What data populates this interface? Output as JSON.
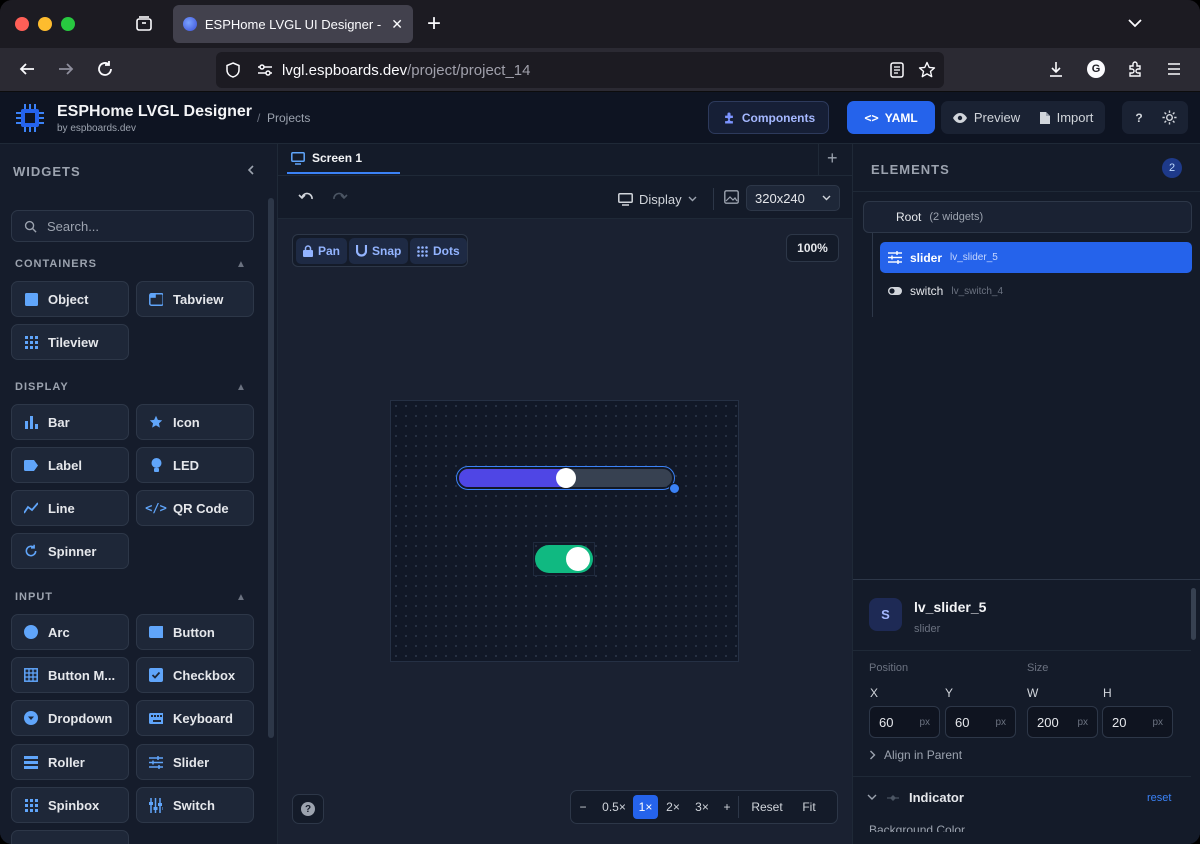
{
  "browser": {
    "tab_title": "ESPHome LVGL UI Designer - Fr",
    "url_domain": "lvgl.espboards.dev",
    "url_path": "/project/project_14",
    "avatar_letter": "G"
  },
  "header": {
    "app_title": "ESPHome LVGL Designer",
    "app_subtitle": "by espboards.dev",
    "breadcrumb_sep": "/",
    "breadcrumb": "Projects",
    "components_label": "Components",
    "yaml_label": "YAML",
    "preview_label": "Preview",
    "import_label": "Import",
    "help_label": "?"
  },
  "widgets_panel": {
    "title": "WIDGETS",
    "search_placeholder": "Search...",
    "sections": {
      "containers": "CONTAINERS",
      "display": "DISPLAY",
      "input": "INPUT"
    },
    "items": {
      "object": "Object",
      "tabview": "Tabview",
      "tileview": "Tileview",
      "bar": "Bar",
      "icon": "Icon",
      "label": "Label",
      "led": "LED",
      "line": "Line",
      "qrcode": "QR Code",
      "spinner": "Spinner",
      "arc": "Arc",
      "button": "Button",
      "buttonmatrix": "Button M...",
      "checkbox": "Checkbox",
      "dropdown": "Dropdown",
      "keyboard": "Keyboard",
      "roller": "Roller",
      "slider": "Slider",
      "spinbox": "Spinbox",
      "switch": "Switch"
    }
  },
  "canvas": {
    "screen_tab": "Screen 1",
    "add_tab": "+",
    "display_label": "Display",
    "resolution": "320x240",
    "pan_label": "Pan",
    "snap_label": "Snap",
    "dots_label": "Dots",
    "zoom_level": "100%",
    "slider_value": 0.5,
    "switch_on": true,
    "zoom_controls": {
      "minus": "−",
      "half": "0.5×",
      "one": "1×",
      "two": "2×",
      "three": "3×",
      "plus": "+",
      "reset": "Reset",
      "fit": "Fit"
    },
    "help_label": "?"
  },
  "elements_panel": {
    "title": "ELEMENTS",
    "count": "2",
    "root_label": "Root",
    "root_count": "(2 widgets)",
    "items": [
      {
        "type": "slider",
        "id": "lv_slider_5"
      },
      {
        "type": "switch",
        "id": "lv_switch_4"
      }
    ]
  },
  "properties": {
    "avatar": "S",
    "name": "lv_slider_5",
    "type": "slider",
    "position_label": "Position",
    "size_label": "Size",
    "x_label": "X",
    "y_label": "Y",
    "w_label": "W",
    "h_label": "H",
    "x": "60",
    "y": "60",
    "w": "200",
    "h": "20",
    "unit": "px",
    "align_label": "Align in Parent",
    "indicator_label": "Indicator",
    "reset_label": "reset",
    "cut_label": "Background Color"
  },
  "colors": {
    "accent": "#2563eb",
    "slider_fill": "#4f46e5",
    "switch_on": "#10b981"
  }
}
